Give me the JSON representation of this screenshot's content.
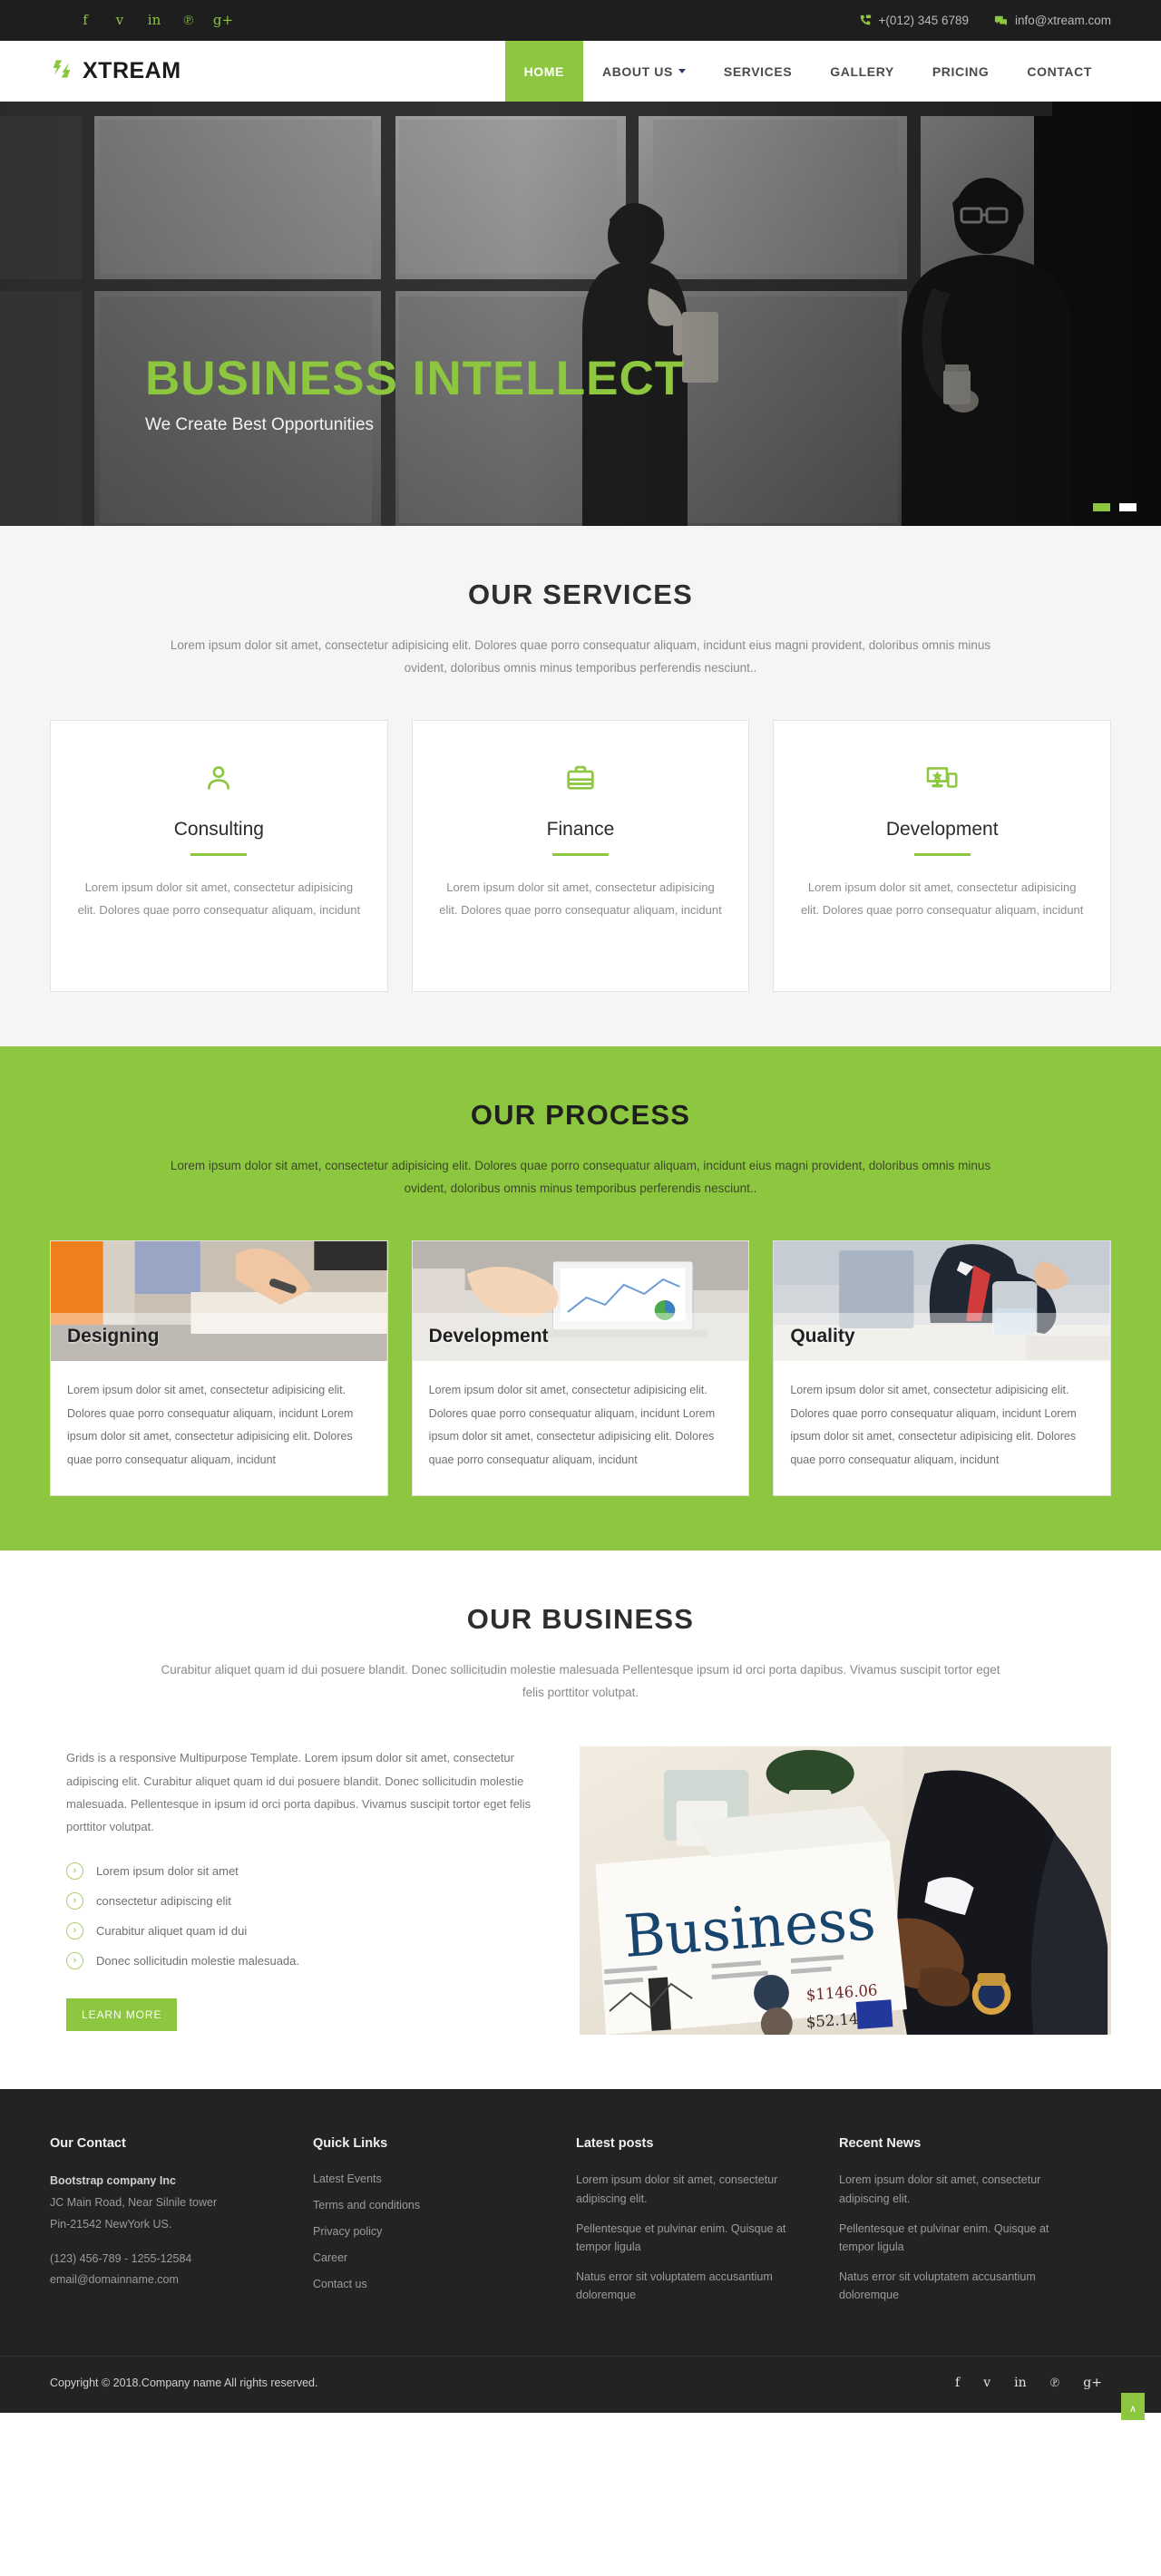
{
  "topbar": {
    "social": [
      {
        "name": "facebook-icon",
        "glyph": "f"
      },
      {
        "name": "twitter-icon",
        "glyph": "ᴠ"
      },
      {
        "name": "linkedin-icon",
        "glyph": "in"
      },
      {
        "name": "pinterest-icon",
        "glyph": "℗"
      },
      {
        "name": "google-plus-icon",
        "glyph": "g+"
      }
    ],
    "phone": "+(012) 345 6789",
    "email": "info@xtream.com"
  },
  "nav": {
    "brand": "XTREAM",
    "items": [
      {
        "label": "HOME",
        "active": true,
        "caret": false
      },
      {
        "label": "ABOUT US",
        "active": false,
        "caret": true
      },
      {
        "label": "SERVICES",
        "active": false,
        "caret": false
      },
      {
        "label": "GALLERY",
        "active": false,
        "caret": false
      },
      {
        "label": "PRICING",
        "active": false,
        "caret": false
      },
      {
        "label": "CONTACT",
        "active": false,
        "caret": false
      }
    ]
  },
  "hero": {
    "title": "BUSINESS INTELLECT",
    "subtitle": "We Create Best Opportunities",
    "slides": [
      {
        "active": true
      },
      {
        "active": false
      }
    ]
  },
  "services": {
    "title": "OUR SERVICES",
    "description": "Lorem ipsum dolor sit amet, consectetur adipisicing elit. Dolores quae porro consequatur aliquam, incidunt eius magni provident, doloribus omnis minus ovident, doloribus omnis minus temporibus perferendis nesciunt..",
    "cards": [
      {
        "icon": "user-icon",
        "title": "Consulting",
        "body": "Lorem ipsum dolor sit amet, consectetur adipisicing elit. Dolores quae porro consequatur aliquam, incidunt"
      },
      {
        "icon": "briefcase-icon",
        "title": "Finance",
        "body": "Lorem ipsum dolor sit amet, consectetur adipisicing elit. Dolores quae porro consequatur aliquam, incidunt"
      },
      {
        "icon": "responsive-devices-icon",
        "title": "Development",
        "body": "Lorem ipsum dolor sit amet, consectetur adipisicing elit. Dolores quae porro consequatur aliquam, incidunt"
      }
    ]
  },
  "process": {
    "title": "OUR PROCESS",
    "description": "Lorem ipsum dolor sit amet, consectetur adipisicing elit. Dolores quae porro consequatur aliquam, incidunt eius magni provident, doloribus omnis minus ovident, doloribus omnis minus temporibus perferendis nesciunt..",
    "cards": [
      {
        "caption": "Designing",
        "body": "Lorem ipsum dolor sit amet, consectetur adipisicing elit. Dolores quae porro consequatur aliquam, incidunt Lorem ipsum dolor sit amet, consectetur adipisicing elit. Dolores quae porro consequatur aliquam, incidunt"
      },
      {
        "caption": "Development",
        "body": "Lorem ipsum dolor sit amet, consectetur adipisicing elit. Dolores quae porro consequatur aliquam, incidunt Lorem ipsum dolor sit amet, consectetur adipisicing elit. Dolores quae porro consequatur aliquam, incidunt"
      },
      {
        "caption": "Quality",
        "body": "Lorem ipsum dolor sit amet, consectetur adipisicing elit. Dolores quae porro consequatur aliquam, incidunt Lorem ipsum dolor sit amet, consectetur adipisicing elit. Dolores quae porro consequatur aliquam, incidunt"
      }
    ]
  },
  "business": {
    "title": "OUR BUSINESS",
    "description": "Curabitur aliquet quam id dui posuere blandit. Donec sollicitudin molestie malesuada Pellentesque ipsum id orci porta dapibus. Vivamus suscipit tortor eget felis porttitor volutpat.",
    "paragraph": "Grids is a responsive Multipurpose Template. Lorem ipsum dolor sit amet, consectetur adipiscing elit. Curabitur aliquet quam id dui posuere blandit. Donec sollicitudin molestie malesuada. Pellentesque in ipsum id orci porta dapibus. Vivamus suscipit tortor eget felis porttitor volutpat.",
    "list": [
      "Lorem ipsum dolor sit amet",
      "consectetur adipiscing elit",
      "Curabitur aliquet quam id dui",
      "Donec sollicitudin molestie malesuada."
    ],
    "button": "LEARN MORE",
    "image_caption": "Business"
  },
  "footer": {
    "contact": {
      "heading": "Our Contact",
      "company": "Bootstrap company Inc",
      "address_line1": "JC Main Road, Near Silnile tower",
      "address_line2": "Pin-21542 NewYork US.",
      "phone": "(123) 456-789 - 1255-12584",
      "email": "email@domainname.com"
    },
    "quick_links": {
      "heading": "Quick Links",
      "items": [
        "Latest Events",
        "Terms and conditions",
        "Privacy policy",
        "Career",
        "Contact us"
      ]
    },
    "latest_posts": {
      "heading": "Latest posts",
      "items": [
        "Lorem ipsum dolor sit amet, consectetur adipiscing elit.",
        "Pellentesque et pulvinar enim. Quisque at tempor ligula",
        "Natus error sit voluptatem accusantium doloremque"
      ]
    },
    "recent_news": {
      "heading": "Recent News",
      "items": [
        "Lorem ipsum dolor sit amet, consectetur adipiscing elit.",
        "Pellentesque et pulvinar enim. Quisque at tempor ligula",
        "Natus error sit voluptatem accusantium doloremque"
      ]
    }
  },
  "copyright": {
    "text": "Copyright © 2018.Company name All rights reserved.",
    "social": [
      {
        "name": "facebook-icon",
        "glyph": "f"
      },
      {
        "name": "twitter-icon",
        "glyph": "ᴠ"
      },
      {
        "name": "linkedin-icon",
        "glyph": "in"
      },
      {
        "name": "pinterest-icon",
        "glyph": "℗"
      },
      {
        "name": "google-plus-icon",
        "glyph": "g+"
      }
    ],
    "to_top": "∧"
  },
  "colors": {
    "accent": "#8dc63f",
    "dark": "#232323",
    "topbar": "#1e1e1e",
    "muted_text": "#8a8a8a"
  }
}
